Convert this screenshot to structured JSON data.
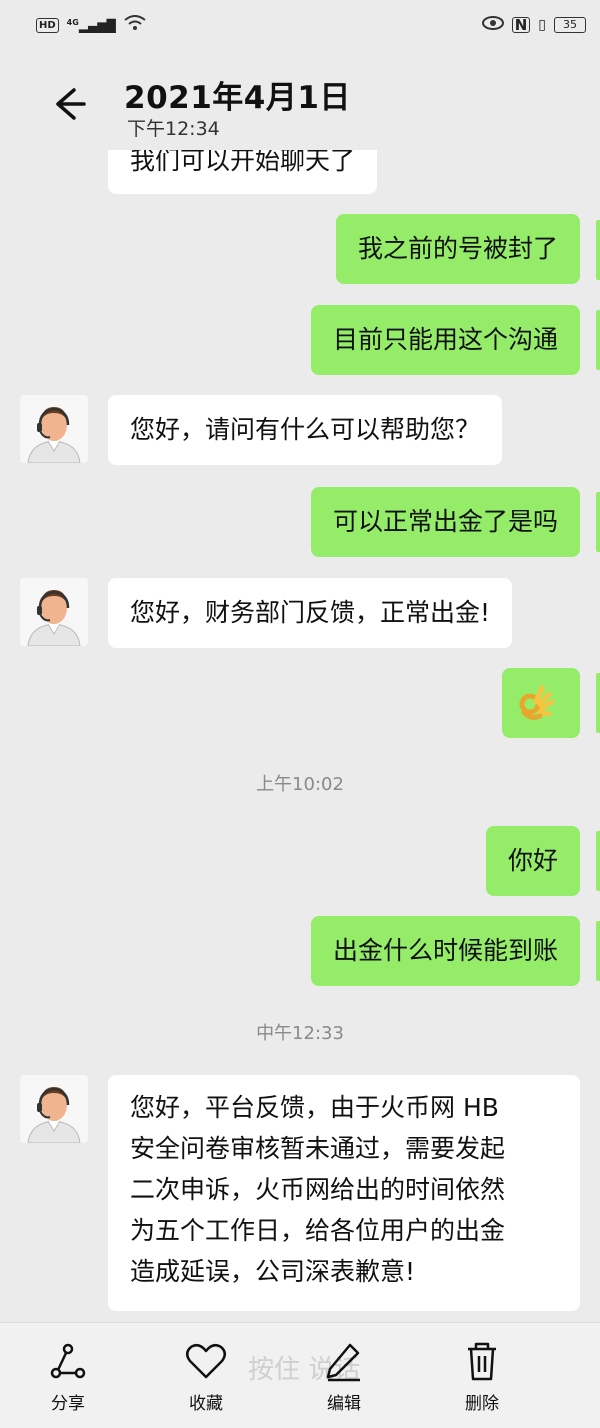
{
  "status_bar": {
    "hd": "HD",
    "network": "4G",
    "battery": "35"
  },
  "header": {
    "title": "2021年4月1日",
    "subtitle": "下午12:34"
  },
  "messages": [
    {
      "side": "in",
      "text": "我们可以开始聊天了"
    },
    {
      "side": "out",
      "text": "我之前的号被封了"
    },
    {
      "side": "out",
      "text": "目前只能用这个沟通"
    },
    {
      "side": "in",
      "text": "您好，请问有什么可以帮助您？"
    },
    {
      "side": "out",
      "text": "可以正常出金了是吗"
    },
    {
      "side": "in",
      "text": "您好，财务部门反馈，正常出金!"
    },
    {
      "side": "out",
      "emoji": "ok-hand"
    },
    {
      "timestamp": "上午10:02"
    },
    {
      "side": "out",
      "text": "你好"
    },
    {
      "side": "out",
      "text": "出金什么时候能到账"
    },
    {
      "timestamp": "中午12:33"
    },
    {
      "side": "in",
      "lines": [
        "您好，平台反馈，由于火币网 HB",
        "安全问卷审核暂未通过，需要发起",
        "二次申诉，火币网给出的时间依然",
        "为五个工作日，给各位用户的出金",
        "造成延误，公司深表歉意!"
      ]
    }
  ],
  "toolbar": {
    "ghost_text": "按住 说话",
    "share": "分享",
    "favorite": "收藏",
    "edit": "编辑",
    "delete": "删除"
  },
  "colors": {
    "background": "#ebebeb",
    "outgoing_bubble": "#95ec69",
    "incoming_bubble": "#ffffff"
  }
}
